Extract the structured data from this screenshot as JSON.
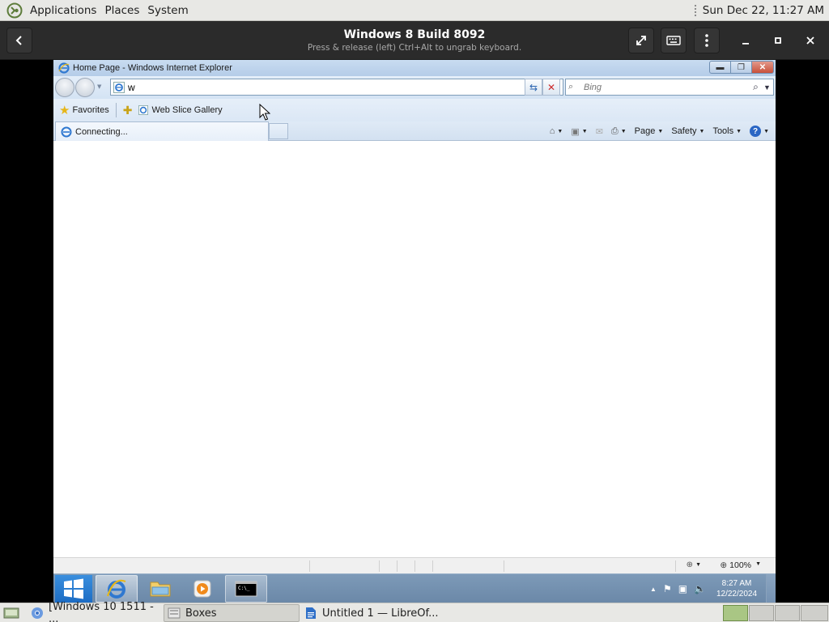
{
  "host_top": {
    "menus": [
      "Applications",
      "Places",
      "System"
    ],
    "clock": "Sun Dec 22, 11:27 AM"
  },
  "boxes": {
    "title": "Windows 8 Build 8092",
    "subtitle": "Press & release (left) Ctrl+Alt to ungrab keyboard."
  },
  "ie": {
    "window_title": "Home Page - Windows Internet Explorer",
    "address_value": "w",
    "search_placeholder": "Bing",
    "favorites_label": "Favorites",
    "web_slice_label": "Web Slice Gallery",
    "tab_label": "Connecting...",
    "cmd": {
      "page": "Page",
      "safety": "Safety",
      "tools": "Tools",
      "help_glyph": "?"
    },
    "zoom": "100%"
  },
  "win_taskbar": {
    "time": "8:27 AM",
    "date": "12/22/2024"
  },
  "host_bottom": {
    "items": [
      {
        "label": "[Windows 10 1511 - ..."
      },
      {
        "label": "Boxes"
      },
      {
        "label": "Untitled 1 — LibreOf..."
      }
    ]
  },
  "colors": {
    "boxes_header": "#2b2b2b",
    "ie_chrome": "#d4e3f4",
    "win_taskbar": "#6b88a8",
    "workspace_active": "#a9c684"
  }
}
